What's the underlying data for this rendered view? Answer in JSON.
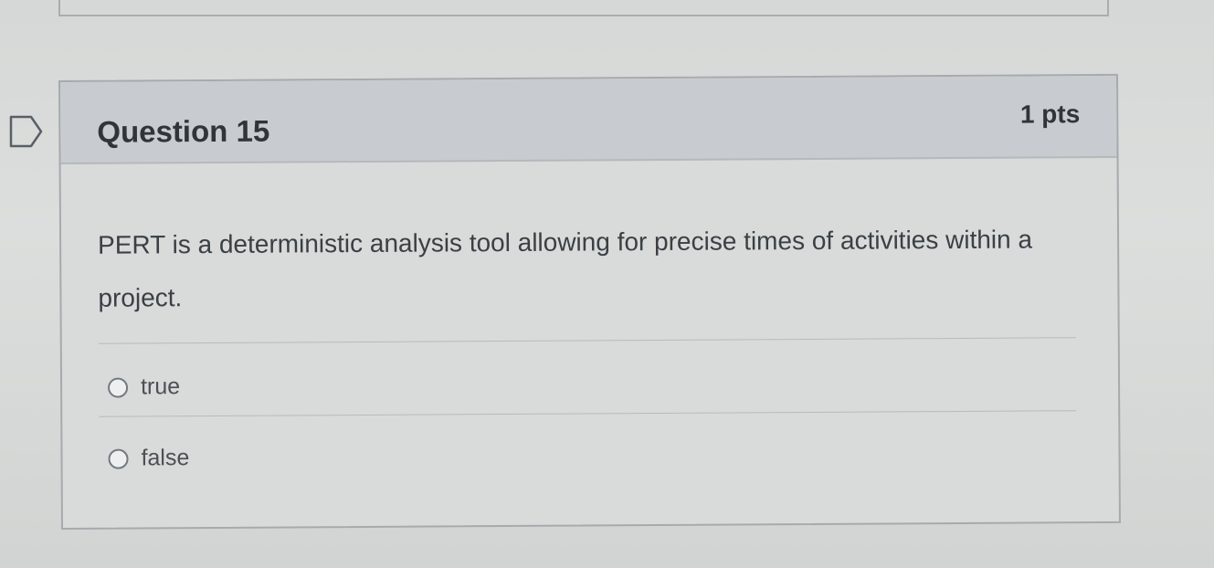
{
  "question": {
    "title": "Question 15",
    "points": "1 pts",
    "text": "PERT is a deterministic analysis tool allowing for precise times of activities within a project.",
    "flag_icon": "flag-bookmark-icon",
    "answers": [
      {
        "label": "true",
        "selected": false
      },
      {
        "label": "false",
        "selected": false
      }
    ]
  },
  "colors": {
    "page_background": "#d9dbda",
    "header_background": "#c8cbcf",
    "border": "#a6aaad",
    "text": "#3a4044"
  }
}
